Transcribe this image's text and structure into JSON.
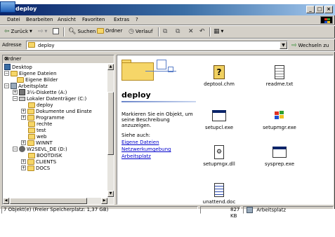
{
  "window": {
    "title": "deploy"
  },
  "menu": [
    "Datei",
    "Bearbeiten",
    "Ansicht",
    "Favoriten",
    "Extras",
    "?"
  ],
  "toolbar": {
    "back": "Zurück",
    "search": "Suchen",
    "folders": "Ordner",
    "history": "Verlauf"
  },
  "address": {
    "label": "Adresse",
    "value": "deploy",
    "go": "Wechseln zu"
  },
  "left_pane": {
    "title": "Ordner",
    "tree": [
      "Desktop",
      "Eigene Dateien",
      "Eigene Bilder",
      "Arbeitsplatz",
      "3½-Diskette (A:)",
      "Lokaler Datenträger (C:)",
      "deploy",
      "Dokumente und Einste",
      "Programme",
      "rechte",
      "test",
      "web",
      "WINNT",
      "W2SEVL_DE (D:)",
      "BOOTDISK",
      "CLIENTS",
      "DOCS"
    ]
  },
  "right_pane": {
    "folder_title": "deploy",
    "info": "Markieren Sie ein Objekt, um seine Beschreibung anzuzeigen.",
    "see_also": "Siehe auch:",
    "links": [
      "Eigene Dateien",
      "Netzwerkumgebung",
      "Arbeitsplatz"
    ],
    "files": [
      {
        "name": "deptool.chm",
        "icon": "chm-help-icon"
      },
      {
        "name": "readme.txt",
        "icon": "text-file-icon"
      },
      {
        "name": "setupcl.exe",
        "icon": "exe-window-icon"
      },
      {
        "name": "setupmgr.exe",
        "icon": "setup-manager-icon"
      },
      {
        "name": "setupmgx.dll",
        "icon": "dll-gear-icon"
      },
      {
        "name": "sysprep.exe",
        "icon": "exe-window-icon"
      },
      {
        "name": "unattend.doc",
        "icon": "doc-file-icon"
      }
    ]
  },
  "status": {
    "objects": "7 Objekt(e) (Freier Speicherplatz: 1,37 GB)",
    "size": "827 KB",
    "zone": "Arbeitsplatz"
  }
}
